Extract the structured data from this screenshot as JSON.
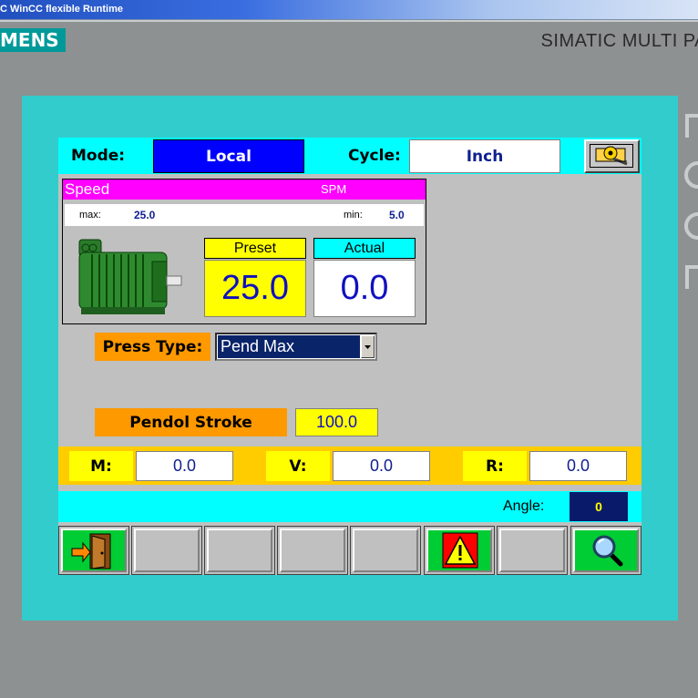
{
  "window": {
    "title": "C WinCC flexible Runtime"
  },
  "device": {
    "brand": "MENS",
    "model": "SIMATIC MULTI PA"
  },
  "mode": {
    "label": "Mode:",
    "value": "Local"
  },
  "cycle": {
    "label": "Cycle:",
    "value": "Inch"
  },
  "speed": {
    "title": "Speed",
    "unit": "SPM",
    "max_label": "max:",
    "max_value": "25.0",
    "min_label": "min:",
    "min_value": "5.0",
    "preset_label": "Preset",
    "preset_value": "25.0",
    "actual_label": "Actual",
    "actual_value": "0.0"
  },
  "press_type": {
    "label": "Press Type:",
    "value": "Pend Max"
  },
  "pendol_stroke": {
    "label": "Pendol Stroke",
    "value": "100.0"
  },
  "mvr": {
    "m_label": "M:",
    "m_value": "0.0",
    "v_label": "V:",
    "v_value": "0.0",
    "r_label": "R:",
    "r_value": "0.0"
  },
  "angle": {
    "label": "Angle:",
    "value": "0"
  },
  "function_keys": [
    "exit-door-icon",
    "",
    "",
    "",
    "",
    "warning-icon",
    "",
    "search-icon"
  ],
  "colors": {
    "frame": "#33cccc",
    "screen": "#c0c0c0",
    "mode_value_bg": "#0000ff",
    "speed_header": "#ff00ff",
    "orange_label": "#ff9900",
    "yellow": "#ffff00",
    "function_green": "#00cc33"
  }
}
